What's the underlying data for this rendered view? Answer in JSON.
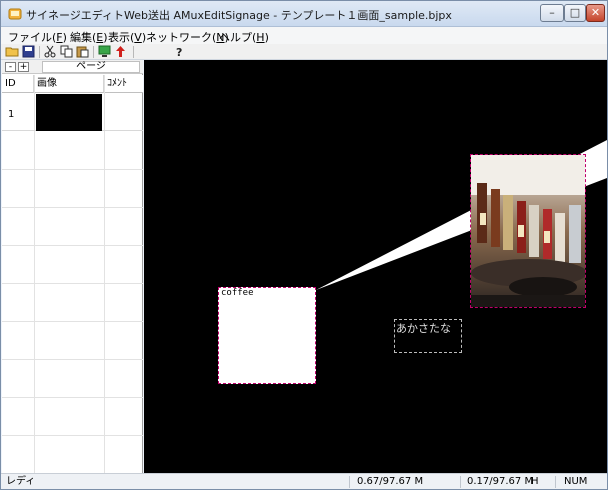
{
  "window": {
    "title": "サイネージエディトWeb送出 AMuxEditSignage - テンプレート１画面_sample.bjpx",
    "controls": {
      "minimize": "–",
      "maximize": "□",
      "close": "✕"
    }
  },
  "menu": [
    {
      "label": "ファイル(",
      "accel": "F",
      "tail": ")"
    },
    {
      "label": "編集(",
      "accel": "E",
      "tail": ")"
    },
    {
      "label": "表示(",
      "accel": "V",
      "tail": ")"
    },
    {
      "label": "ネットワーク(",
      "accel": "N",
      "tail": ")"
    },
    {
      "label": "ヘルプ(",
      "accel": "H",
      "tail": ")"
    }
  ],
  "toolbar": {
    "icons": [
      "open-folder-icon",
      "save-icon",
      "cut-icon",
      "copy-icon",
      "paste-icon",
      "monitor-icon",
      "upload-arrow-icon",
      "help-icon"
    ]
  },
  "page_panel": {
    "minus_label": "-",
    "plus_label": "+",
    "header_label": "ページ",
    "columns": [
      "ID",
      "画像",
      "ｺﾒﾝﾄ"
    ],
    "rows": [
      {
        "id": "1",
        "comment": ""
      }
    ]
  },
  "canvas": {
    "background": "#000000",
    "coffee_text": "coffee",
    "text_object": "あかさたな"
  },
  "status": {
    "ready": "レディ",
    "memory_1": "0.67/97.67 M",
    "memory_2": "0.17/97.67 M",
    "memory_2_flag": "H",
    "numlock": "NUM"
  }
}
